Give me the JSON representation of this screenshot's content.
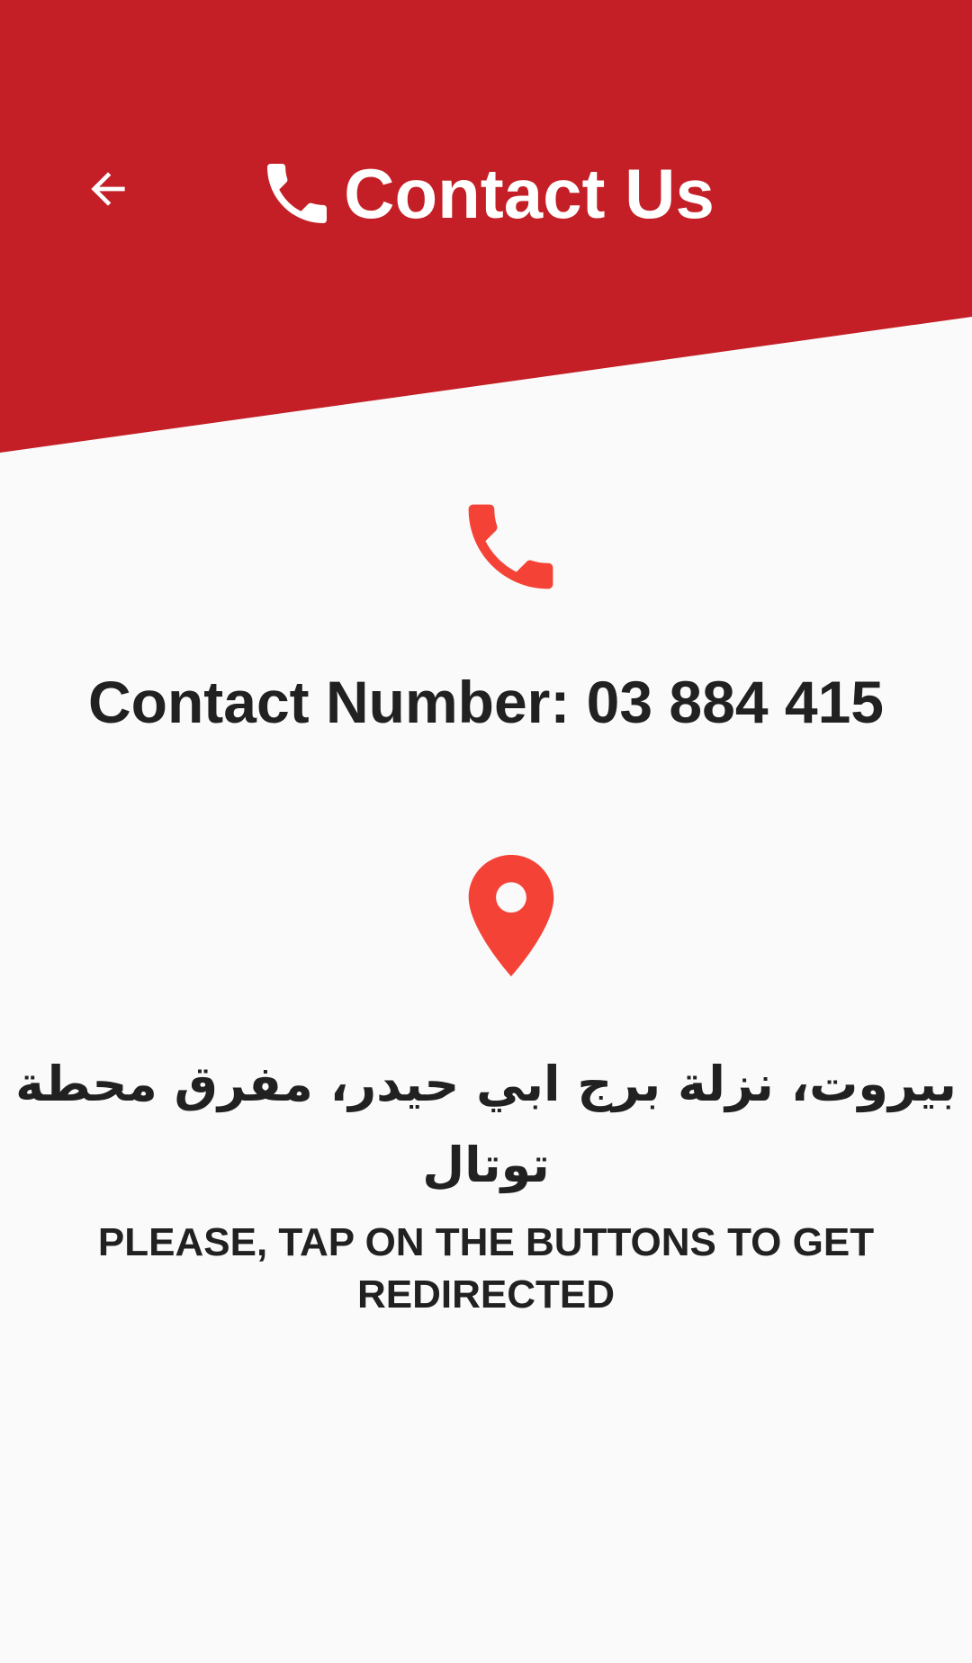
{
  "header": {
    "title": "Contact Us",
    "back_icon": "arrow-back-icon",
    "title_icon": "phone-icon"
  },
  "contact": {
    "phone_icon": "phone-icon",
    "number_text": "Contact Number: 03 884 415"
  },
  "location": {
    "icon": "location-pin-icon",
    "address": "بيروت، نزلة برج ابي حيدر، مفرق محطة توتال"
  },
  "instructions": "PLEASE, TAP ON THE BUTTONS TO GET REDIRECTED",
  "colors": {
    "header": "#c41f26",
    "accent": "#f44336",
    "background": "#fafafa",
    "text": "#212121"
  }
}
